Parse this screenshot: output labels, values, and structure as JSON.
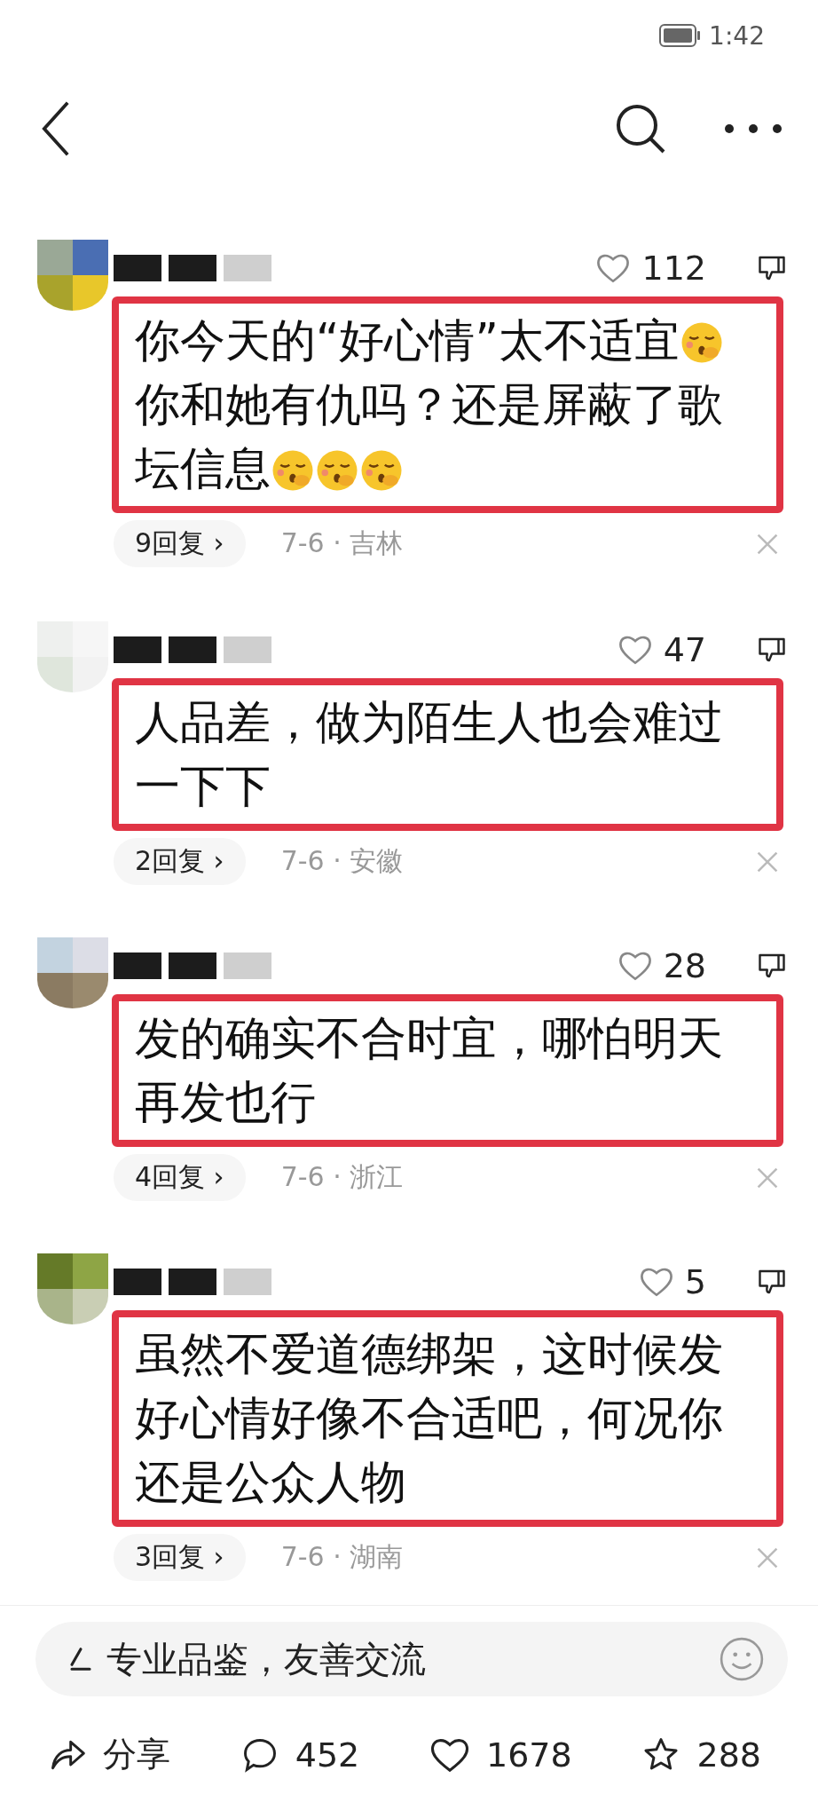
{
  "status_bar": {
    "time": "1:42"
  },
  "comments": [
    {
      "likes": "112",
      "parts": [
        {
          "kind": "text",
          "text": "你今天的“好心情”太不适宜"
        },
        {
          "kind": "emoji"
        },
        {
          "kind": "text",
          "text": "你和她有仇吗？还是屏蔽了歌坛信息"
        },
        {
          "kind": "emoji"
        },
        {
          "kind": "emoji"
        },
        {
          "kind": "emoji"
        }
      ],
      "replies": "9回复 ›",
      "meta": "7-6 · 吉林"
    },
    {
      "likes": "47",
      "parts": [
        {
          "kind": "text",
          "text": "人品差，做为陌生人也会难过一下下"
        }
      ],
      "replies": "2回复 ›",
      "meta": "7-6 · 安徽"
    },
    {
      "likes": "28",
      "parts": [
        {
          "kind": "text",
          "text": "发的确实不合时宜，哪怕明天再发也行"
        }
      ],
      "replies": "4回复 ›",
      "meta": "7-6 · 浙江"
    },
    {
      "likes": "5",
      "parts": [
        {
          "kind": "text",
          "text": "虽然不爱道德绑架，这时候发好心情好像不合适吧，何况你还是公众人物"
        }
      ],
      "replies": "3回复 ›",
      "meta": "7-6 · 湖南"
    }
  ],
  "composer": {
    "placeholder": "专业品鉴，友善交流"
  },
  "actions": [
    {
      "kind": "share",
      "label": "分享"
    },
    {
      "kind": "comment",
      "label": "452"
    },
    {
      "kind": "like",
      "label": "1678"
    },
    {
      "kind": "star",
      "label": "288"
    }
  ]
}
